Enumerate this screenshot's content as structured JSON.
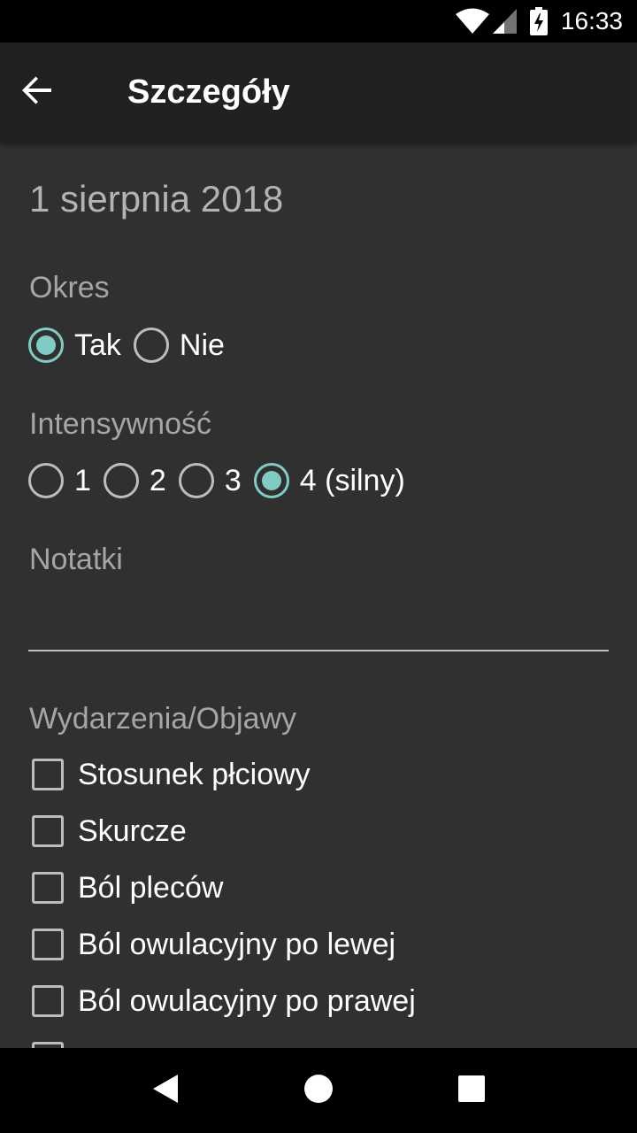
{
  "status_bar": {
    "time": "16:33",
    "icons": [
      "wifi-icon",
      "signal-icon",
      "battery-charging-icon"
    ]
  },
  "app_bar": {
    "title": "Szczegóły",
    "back_icon": "arrow-back-icon"
  },
  "details": {
    "date": "1 sierpnia 2018",
    "period": {
      "label": "Okres",
      "options": [
        {
          "label": "Tak",
          "checked": true
        },
        {
          "label": "Nie",
          "checked": false
        }
      ]
    },
    "intensity": {
      "label": "Intensywność",
      "options": [
        {
          "label": "1",
          "checked": false
        },
        {
          "label": "2",
          "checked": false
        },
        {
          "label": "3",
          "checked": false
        },
        {
          "label": "4 (silny)",
          "checked": true
        }
      ]
    },
    "notes": {
      "label": "Notatki",
      "value": ""
    },
    "events": {
      "label": "Wydarzenia/Objawy",
      "items": [
        {
          "label": "Stosunek płciowy",
          "checked": false
        },
        {
          "label": "Skurcze",
          "checked": false
        },
        {
          "label": "Ból pleców",
          "checked": false
        },
        {
          "label": "Ból owulacyjny po lewej",
          "checked": false
        },
        {
          "label": "Ból owulacyjny po prawej",
          "checked": false
        }
      ]
    }
  },
  "nav_bar": {
    "icons": [
      "back-triangle-icon",
      "home-circle-icon",
      "recents-square-icon"
    ]
  },
  "colors": {
    "accent": "#80cbc4",
    "background": "#303030",
    "app_bar": "#212121"
  }
}
